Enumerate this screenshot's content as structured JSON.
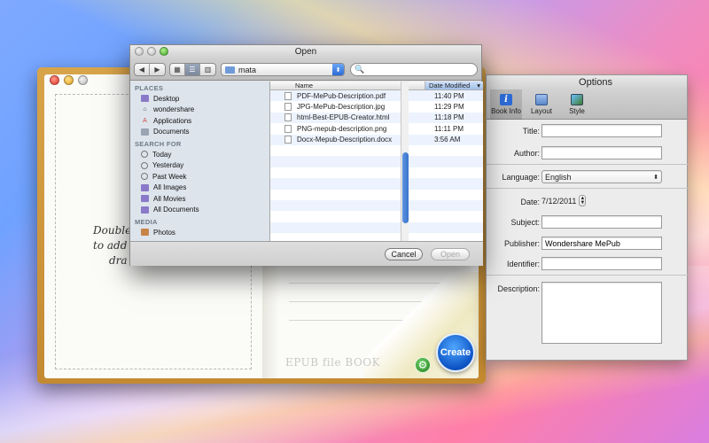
{
  "book": {
    "drop_line1": "Double",
    "drop_line2": "to add",
    "drop_line3": "dra",
    "watermark": "EPUB file BOOK",
    "create_label": "Create"
  },
  "open_dialog": {
    "title": "Open",
    "location": "mata",
    "search_placeholder": "",
    "sidebar": {
      "places_header": "PLACES",
      "places": [
        "Desktop",
        "wondershare",
        "Applications",
        "Documents"
      ],
      "search_header": "SEARCH FOR",
      "search_for": [
        "Today",
        "Yesterday",
        "Past Week",
        "All Images",
        "All Movies",
        "All Documents"
      ],
      "media_header": "MEDIA",
      "media": [
        "Photos"
      ]
    },
    "columns": {
      "name": "Name",
      "date": "Date Modified"
    },
    "files": [
      {
        "name": "PDF-MePub-Description.pdf",
        "date": "11:40 PM"
      },
      {
        "name": "JPG-MePub-Description.jpg",
        "date": "11:29 PM"
      },
      {
        "name": "html-Best-EPUB-Creator.html",
        "date": "11:18 PM"
      },
      {
        "name": "PNG-mepub-description.png",
        "date": "11:11 PM"
      },
      {
        "name": "Docx-Mepub-Description.docx",
        "date": "3:56 AM"
      }
    ],
    "cancel_label": "Cancel",
    "open_label": "Open"
  },
  "options": {
    "title": "Options",
    "toolbar": [
      "Book Info",
      "Layout",
      "Style"
    ],
    "fields": {
      "title_label": "Title:",
      "title_value": "",
      "author_label": "Author:",
      "author_value": "",
      "language_label": "Language:",
      "language_value": "English",
      "date_label": "Date:",
      "date_value": "7/12/2011",
      "subject_label": "Subject:",
      "subject_value": "",
      "publisher_label": "Publisher:",
      "publisher_value": "Wondershare MePub",
      "identifier_label": "Identifier:",
      "identifier_value": "",
      "description_label": "Description:",
      "description_value": ""
    }
  }
}
